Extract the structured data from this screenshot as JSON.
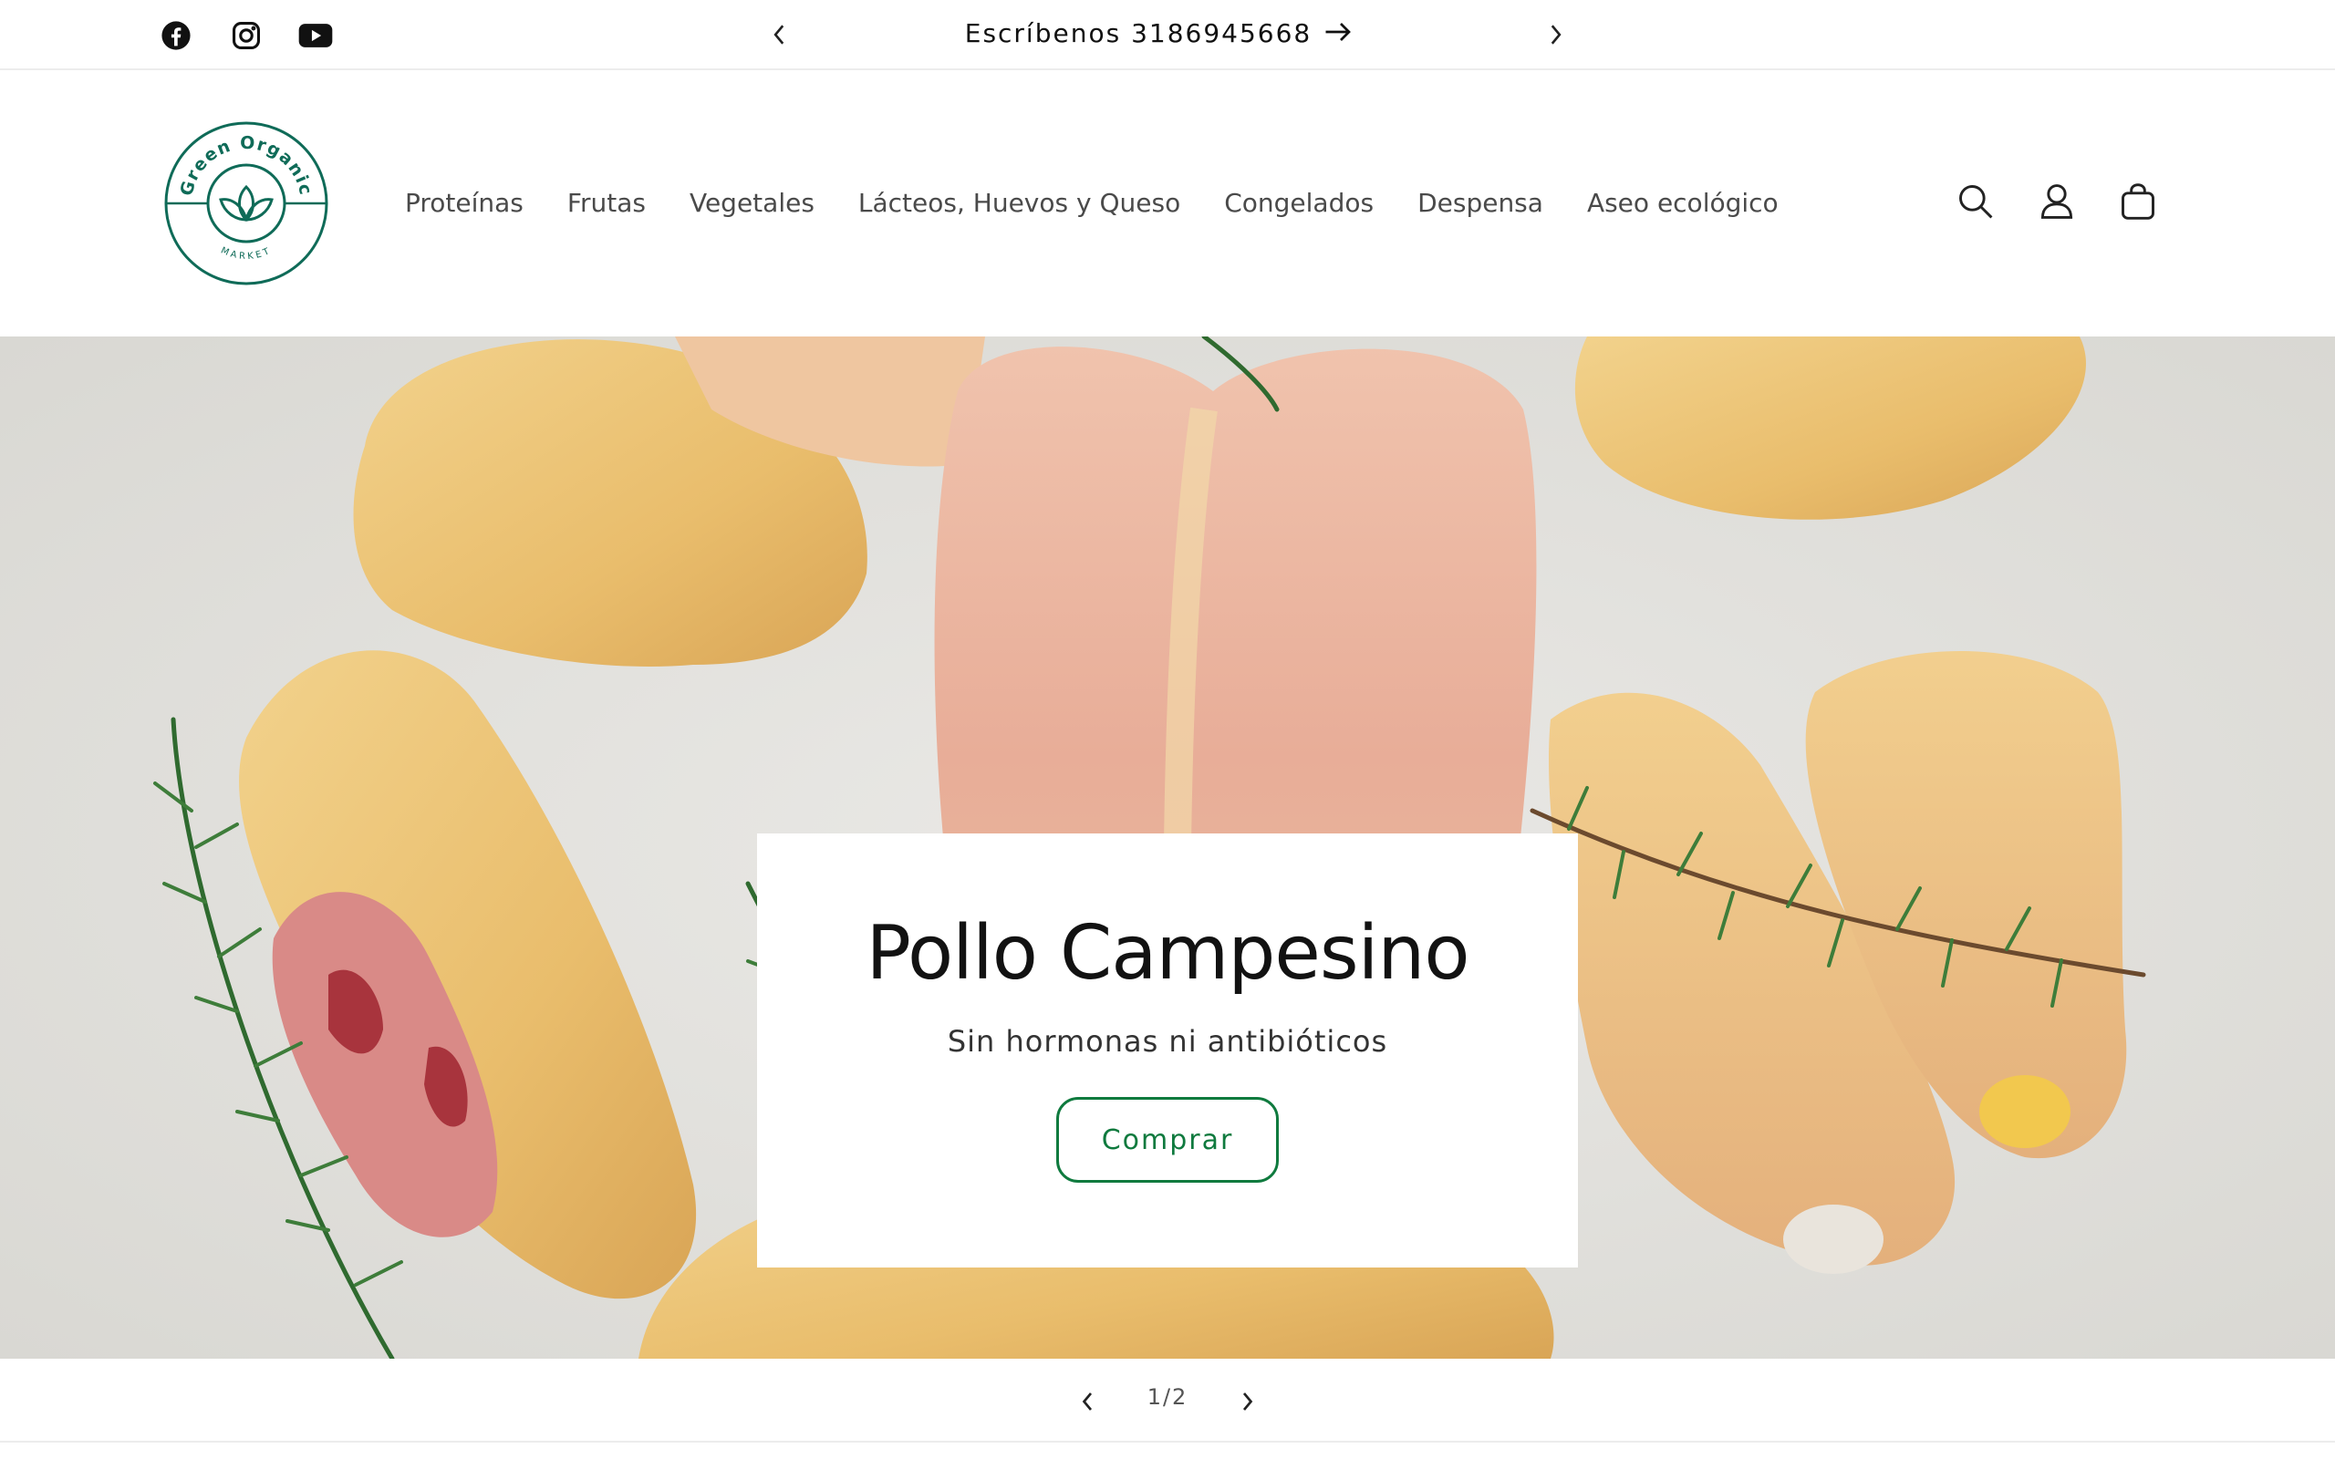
{
  "announcement": {
    "text": "Escríbenos 3186945668",
    "social": [
      "facebook-icon",
      "instagram-icon",
      "youtube-icon"
    ]
  },
  "header": {
    "logo_top_text": "Green Organic",
    "logo_bottom_text": "MARKET",
    "nav": [
      {
        "label": "Proteínas"
      },
      {
        "label": "Frutas"
      },
      {
        "label": "Vegetales"
      },
      {
        "label": "Lácteos, Huevos y Queso"
      },
      {
        "label": "Congelados"
      },
      {
        "label": "Despensa"
      },
      {
        "label": "Aseo ecológico"
      }
    ],
    "icons": [
      "search-icon",
      "account-icon",
      "cart-icon"
    ]
  },
  "hero": {
    "title": "Pollo Campesino",
    "subtitle": "Sin hormonas ni antibióticos",
    "button_label": "Comprar"
  },
  "slider": {
    "counter": "1/2"
  },
  "colors": {
    "brand_green": "#0f7a3e",
    "logo_teal": "#0f6b58"
  }
}
